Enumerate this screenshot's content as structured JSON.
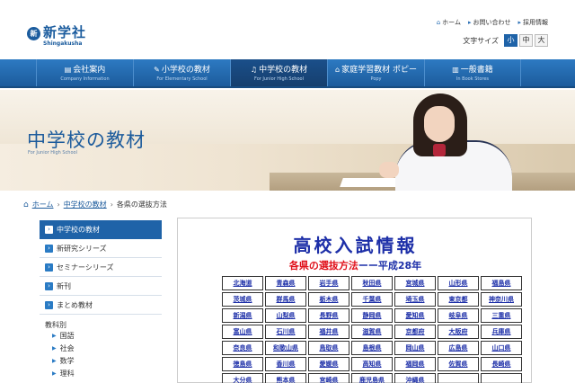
{
  "header": {
    "logo_mark": "新",
    "logo_jp": "新学社",
    "logo_en": "Shingakusha",
    "util_links": [
      {
        "icon": "home-icon",
        "label": "ホーム"
      },
      {
        "icon": "mail-icon",
        "label": "お問い合わせ"
      },
      {
        "icon": "arrow-icon",
        "label": "採用情報"
      }
    ],
    "font_size_label": "文字サイズ",
    "font_sizes": [
      "小",
      "中",
      "大"
    ],
    "font_size_selected": "小"
  },
  "nav": {
    "items": [
      {
        "icon": "building-icon",
        "label": "会社案内",
        "sub": "Company Information"
      },
      {
        "icon": "pencil-icon",
        "label": "小学校の教材",
        "sub": "For Elementary School"
      },
      {
        "icon": "bell-icon",
        "label": "中学校の教材",
        "sub": "For Junior High School",
        "active": true
      },
      {
        "icon": "house-icon",
        "label": "家庭学習教材 ポピー",
        "sub": "Popy"
      },
      {
        "icon": "book-icon",
        "label": "一般書籍",
        "sub": "In Book Stores"
      }
    ]
  },
  "hero": {
    "title": "中学校の教材",
    "subtitle": "For Junior High School"
  },
  "breadcrumb": {
    "home": "ホーム",
    "parent": "中学校の教材",
    "current": "各県の選抜方法"
  },
  "sidebar": {
    "heading": "中学校の教材",
    "items": [
      "新研究シリーズ",
      "セミナーシリーズ",
      "新刊",
      "まとめ教材"
    ],
    "group_label": "教科別",
    "subjects": [
      "国語",
      "社会",
      "数学",
      "理科"
    ]
  },
  "main": {
    "title": "高校入試情報",
    "subtitle_red": "各県の選抜方法",
    "subtitle_blue": "ーー平成28年",
    "prefectures": [
      [
        "北海道",
        "青森県",
        "岩手県",
        "秋田県",
        "宮城県",
        "山形県",
        "福島県"
      ],
      [
        "茨城県",
        "群馬県",
        "栃木県",
        "千葉県",
        "埼玉県",
        "東京都",
        "神奈川県"
      ],
      [
        "新潟県",
        "山梨県",
        "長野県",
        "静岡県",
        "愛知県",
        "岐阜県",
        "三重県"
      ],
      [
        "富山県",
        "石川県",
        "福井県",
        "滋賀県",
        "京都府",
        "大阪府",
        "兵庫県"
      ],
      [
        "奈良県",
        "和歌山県",
        "鳥取県",
        "島根県",
        "岡山県",
        "広島県",
        "山口県"
      ],
      [
        "徳島県",
        "香川県",
        "愛媛県",
        "高知県",
        "福岡県",
        "佐賀県",
        "長崎県"
      ],
      [
        "大分県",
        "熊本県",
        "宮崎県",
        "鹿児島県",
        "沖縄県",
        "",
        ""
      ]
    ]
  },
  "colors": {
    "brand_blue": "#1c5b9c",
    "nav_blue": "#2d7ac2",
    "title_blue": "#1d2fa8",
    "accent_red": "#e0101a"
  }
}
